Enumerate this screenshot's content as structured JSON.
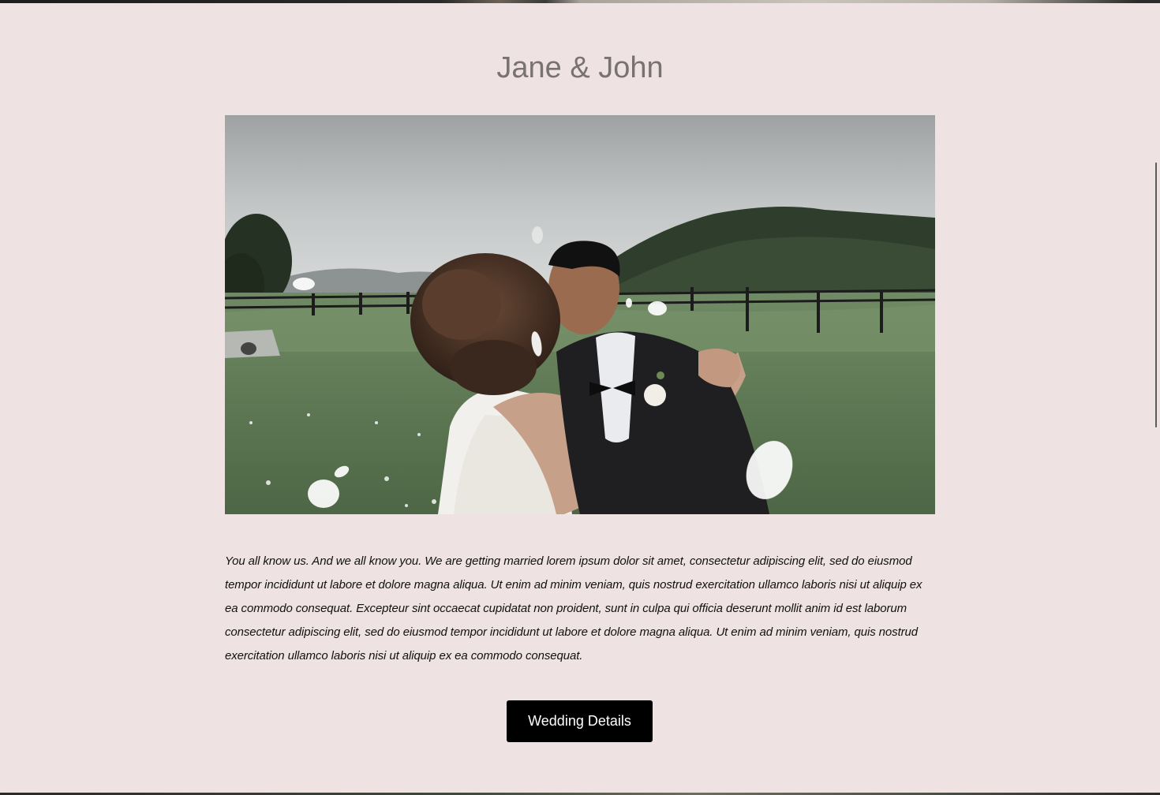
{
  "colors": {
    "background": "#EEE2E2",
    "title": "#797272",
    "body_text": "#111111",
    "button_bg": "#000000",
    "button_text": "#FFFFFF"
  },
  "header": {
    "title": "Jane & John"
  },
  "photo": {
    "alt": "Bride and groom kissing on a grassy field with flower petals falling"
  },
  "story": {
    "text": "You all know us. And we all know you. We are getting married lorem ipsum dolor sit amet, consectetur adipiscing elit, sed do eiusmod tempor incididunt ut labore et dolore magna aliqua. Ut enim ad minim veniam, quis nostrud exercitation ullamco laboris nisi ut aliquip ex ea commodo consequat. Excepteur sint occaecat cupidatat non proident, sunt in culpa qui officia deserunt mollit anim id est laborum consectetur adipiscing elit, sed do eiusmod tempor incididunt ut labore et dolore magna aliqua. Ut enim ad minim veniam, quis nostrud exercitation ullamco laboris nisi ut aliquip ex ea commodo consequat."
  },
  "cta": {
    "label": "Wedding Details"
  }
}
